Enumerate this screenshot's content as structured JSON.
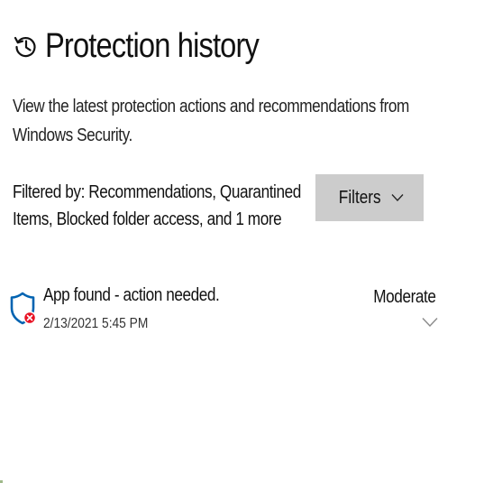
{
  "header": {
    "title": "Protection history",
    "icon": "history-icon"
  },
  "description": "View the latest protection actions and recommendations from Windows Security.",
  "filter": {
    "text": "Filtered by: Recommendations, Quarantined Items, Blocked folder access, and 1 more",
    "button_label": "Filters",
    "button_icon": "chevron-down-icon"
  },
  "items": [
    {
      "title": "App found - action needed.",
      "date": "2/13/2021 5:45 PM",
      "severity": "Moderate",
      "icon": "shield-error-icon",
      "expand_icon": "chevron-down-icon"
    }
  ],
  "colors": {
    "button_bg": "#cccccc",
    "shield_stroke": "#0063b1",
    "error_badge": "#e81123",
    "text": "#111111"
  }
}
